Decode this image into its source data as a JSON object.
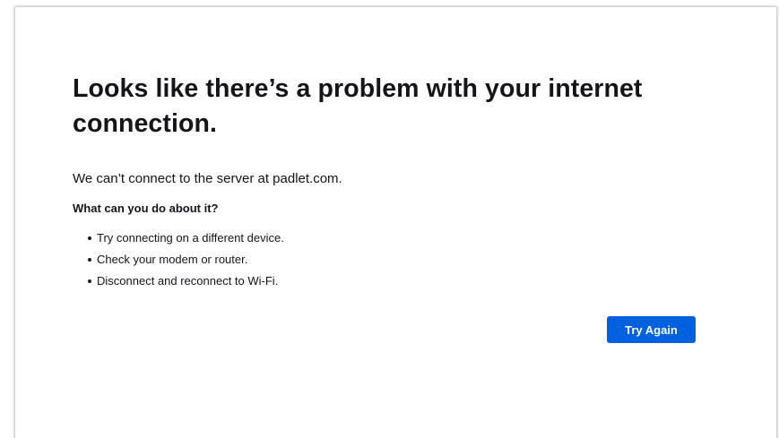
{
  "error": {
    "title": "Looks like there’s a problem with your internet connection.",
    "description": "We can’t connect to the server at padlet.com.",
    "subheading": "What can you do about it?",
    "tips": [
      "Try connecting on a different device.",
      "Check your modem or router.",
      "Disconnect and reconnect to Wi-Fi."
    ],
    "button_label": "Try Again"
  },
  "colors": {
    "button": "#0061e0",
    "text": "#15141a",
    "background": "#ffffff"
  }
}
